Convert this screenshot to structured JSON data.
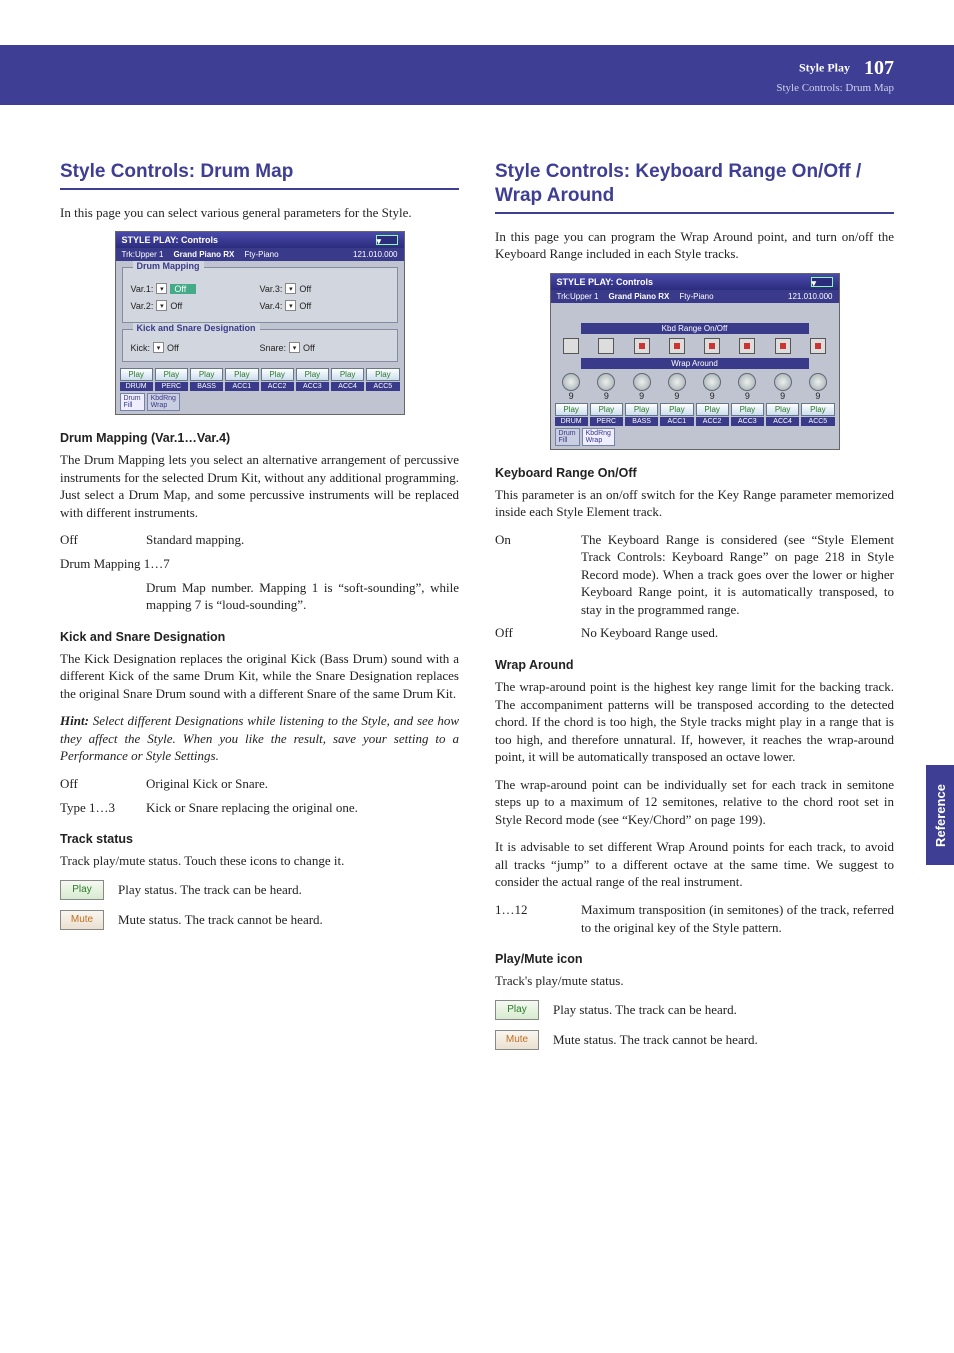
{
  "header": {
    "section": "Style Play",
    "page_num": "107",
    "breadcrumb": "Style Controls: Drum Map"
  },
  "sidetab": "Reference",
  "left": {
    "h1": "Style Controls: Drum Map",
    "intro": "In this page you can select various general parameters for the Style.",
    "shot": {
      "title": "STYLE PLAY: Controls",
      "trk": "Trk:Upper 1",
      "snd": "Grand Piano RX",
      "patch": "Fty-Piano",
      "num": "121.010.000",
      "p1": "Drum Mapping",
      "vars": [
        [
          "Var.1:",
          "Off"
        ],
        [
          "Var.3:",
          "Off"
        ],
        [
          "Var.2:",
          "Off"
        ],
        [
          "Var.4:",
          "Off"
        ]
      ],
      "p2": "Kick and Snare Designation",
      "kick": [
        "Kick:",
        "Off"
      ],
      "snare": [
        "Snare:",
        "Off"
      ],
      "play": "Play",
      "labels": [
        "DRUM",
        "PERC",
        "BASS",
        "ACC1",
        "ACC2",
        "ACC3",
        "ACC4",
        "ACC5"
      ],
      "tabs": [
        [
          "Drum",
          "Fill"
        ],
        [
          "KbdRng",
          "Wrap"
        ]
      ]
    },
    "s1": {
      "h": "Drum Mapping (Var.1…Var.4)",
      "p": "The Drum Mapping lets you select an alternative arrangement of percussive instruments for the selected Drum Kit, without any additional programming. Just select a Drum Map, and some percussive instruments will be replaced with different instruments.",
      "d1t": "Off",
      "d1d": "Standard mapping.",
      "d2t": "Drum Mapping 1…7",
      "d2d": "Drum Map number. Mapping 1 is “soft-sounding”, while mapping 7 is “loud-sounding”."
    },
    "s2": {
      "h": "Kick and Snare Designation",
      "p": "The Kick Designation replaces the original Kick (Bass Drum) sound with a different Kick of the same Drum Kit, while the Snare Designation replaces the original Snare Drum sound with a different Snare of the same Drum Kit.",
      "hint": "Select different Designations while listening to the Style, and see how they affect the Style. When you like the result, save your setting to a Performance or Style Settings.",
      "d1t": "Off",
      "d1d": "Original Kick or Snare.",
      "d2t": "Type 1…3",
      "d2d": "Kick or Snare replacing the original one."
    },
    "s3": {
      "h": "Track status",
      "p": "Track play/mute status. Touch these icons to change it.",
      "play": "Play",
      "playd": "Play status. The track can be heard.",
      "mute": "Mute",
      "muted": "Mute status. The track cannot be heard."
    }
  },
  "right": {
    "h1": "Style Controls: Keyboard Range On/Off / Wrap Around",
    "intro": "In this page you can program the Wrap Around point, and turn on/off the Keyboard Range included in each Style tracks.",
    "shot": {
      "title": "STYLE PLAY: Controls",
      "trk": "Trk:Upper 1",
      "snd": "Grand Piano RX",
      "patch": "Fty-Piano",
      "num": "121.010.000",
      "strip1": "Kbd Range On/Off",
      "strip2": "Wrap Around",
      "knval": "9",
      "play": "Play",
      "labels": [
        "DRUM",
        "PERC",
        "BASS",
        "ACC1",
        "ACC2",
        "ACC3",
        "ACC4",
        "ACC5"
      ],
      "tabs": [
        [
          "Drum",
          "Fill"
        ],
        [
          "KbdRng",
          "Wrap"
        ]
      ]
    },
    "s1": {
      "h": "Keyboard Range On/Off",
      "p": "This parameter is an on/off switch for the Key Range parameter memorized inside each Style Element track.",
      "d1t": "On",
      "d1d": "The Keyboard Range is considered (see “Style Element Track Controls: Keyboard Range” on page 218 in Style Record mode). When a track goes over the lower or higher Keyboard Range point, it is automatically transposed, to stay in the programmed range.",
      "d2t": "Off",
      "d2d": "No Keyboard Range used."
    },
    "s2": {
      "h": "Wrap Around",
      "p1": "The wrap-around point is the highest key range limit for the backing track. The accompaniment patterns will be transposed according to the detected chord. If the chord is too high, the Style tracks might play in a range that is too high, and therefore unnatural. If, however, it reaches the wrap-around point, it will be automatically transposed an octave lower.",
      "p2": "The wrap-around point can be individually set for each track in semitone steps up to a maximum of 12 semitones, relative to the chord root set in Style Record mode (see “Key/Chord” on page 199).",
      "p3": "It is advisable to set different Wrap Around points for each track, to avoid all tracks “jump” to a different octave at the same time. We suggest to consider the actual range of the real instrument.",
      "d1t": "1…12",
      "d1d": "Maximum transposition (in semitones) of the track, referred to the original key of the Style pattern."
    },
    "s3": {
      "h": "Play/Mute icon",
      "p": "Track's play/mute status.",
      "play": "Play",
      "playd": "Play status. The track can be heard.",
      "mute": "Mute",
      "muted": "Mute status. The track cannot be heard."
    }
  }
}
